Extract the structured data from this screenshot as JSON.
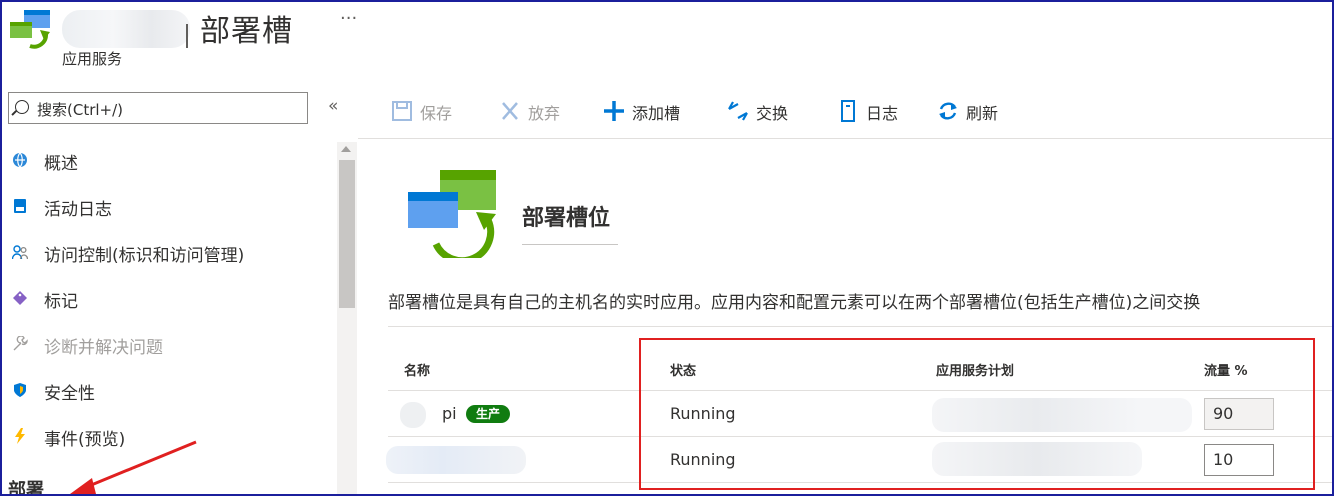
{
  "header": {
    "title": "部署槽",
    "more": "···",
    "subtitle": "应用服务"
  },
  "sidebar": {
    "search_placeholder": "搜索(Ctrl+/)",
    "collapse": "«",
    "items": [
      {
        "label": "概述",
        "icon": "globe-icon",
        "color": "#2b88d8"
      },
      {
        "label": "活动日志",
        "icon": "log-icon",
        "color": "#0078d4"
      },
      {
        "label": "访问控制(标识和访问管理)",
        "icon": "people-icon",
        "color": "#0078d4"
      },
      {
        "label": "标记",
        "icon": "tag-icon",
        "color": "#8661c5"
      },
      {
        "label": "诊断并解决问题",
        "icon": "wrench-icon",
        "color": "#a19f9d"
      },
      {
        "label": "安全性",
        "icon": "shield-icon",
        "color": "#0078d4"
      },
      {
        "label": "事件(预览)",
        "icon": "lightning-icon",
        "color": "#ffb900"
      }
    ],
    "section": "部署"
  },
  "toolbar": {
    "save": "保存",
    "discard": "放弃",
    "add_slot": "添加槽",
    "swap": "交换",
    "log": "日志",
    "refresh": "刷新"
  },
  "content": {
    "title": "部署槽位",
    "description": "部署槽位是具有自己的主机名的实时应用。应用内容和配置元素可以在两个部署槽位(包括生产槽位)之间交换",
    "columns": [
      "名称",
      "状态",
      "应用服务计划",
      "流量 %"
    ],
    "rows": [
      {
        "name": "pi",
        "badge": "生产",
        "status": "Running",
        "traffic": "90"
      },
      {
        "name": "",
        "badge": "",
        "status": "Running",
        "traffic": "10"
      }
    ]
  },
  "colors": {
    "accent": "#0078d4",
    "production_badge": "#107c10",
    "highlight": "#e02020"
  }
}
